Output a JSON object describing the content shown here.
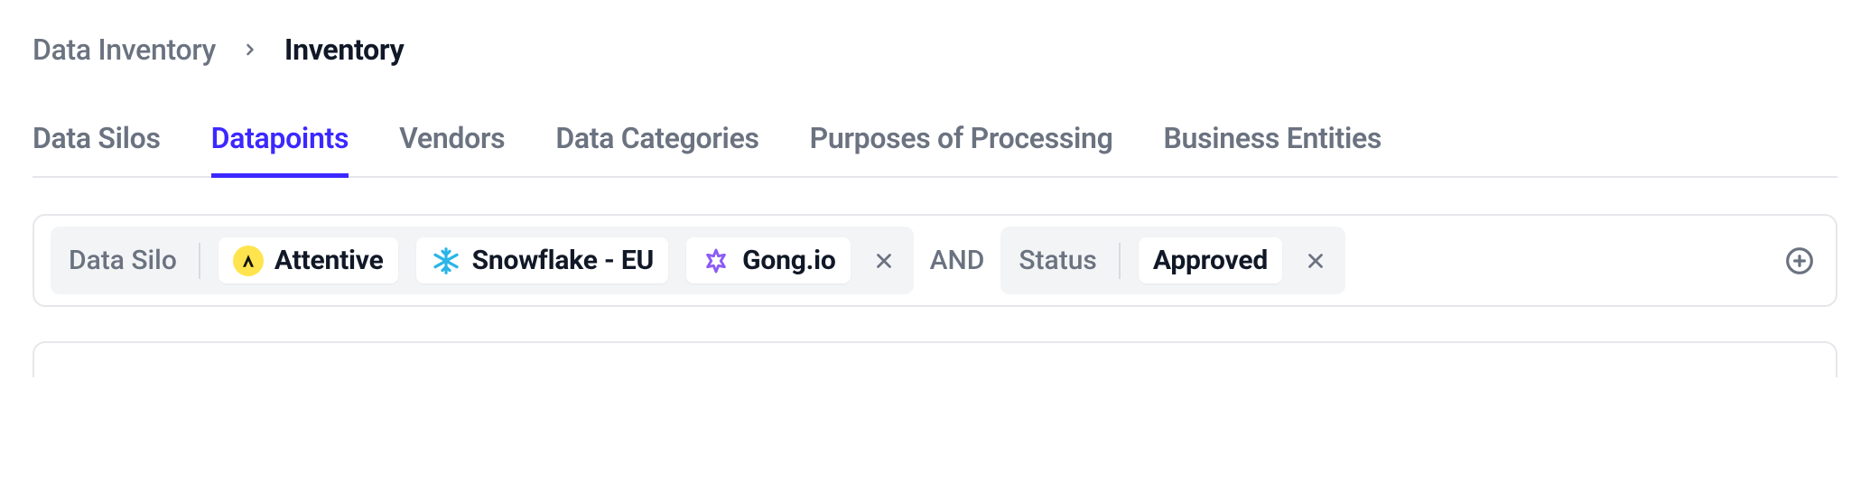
{
  "breadcrumb": {
    "parent": "Data Inventory",
    "current": "Inventory"
  },
  "tabs": [
    {
      "label": "Data Silos",
      "active": false
    },
    {
      "label": "Datapoints",
      "active": true
    },
    {
      "label": "Vendors",
      "active": false
    },
    {
      "label": "Data Categories",
      "active": false
    },
    {
      "label": "Purposes of Processing",
      "active": false
    },
    {
      "label": "Business Entities",
      "active": false
    }
  ],
  "filters": {
    "operator": "AND",
    "groups": [
      {
        "label": "Data Silo",
        "chips": [
          {
            "icon": "attentive",
            "text": "Attentive"
          },
          {
            "icon": "snowflake",
            "text": "Snowflake - EU"
          },
          {
            "icon": "gong",
            "text": "Gong.io"
          }
        ]
      },
      {
        "label": "Status",
        "chips": [
          {
            "icon": null,
            "text": "Approved"
          }
        ]
      }
    ]
  }
}
